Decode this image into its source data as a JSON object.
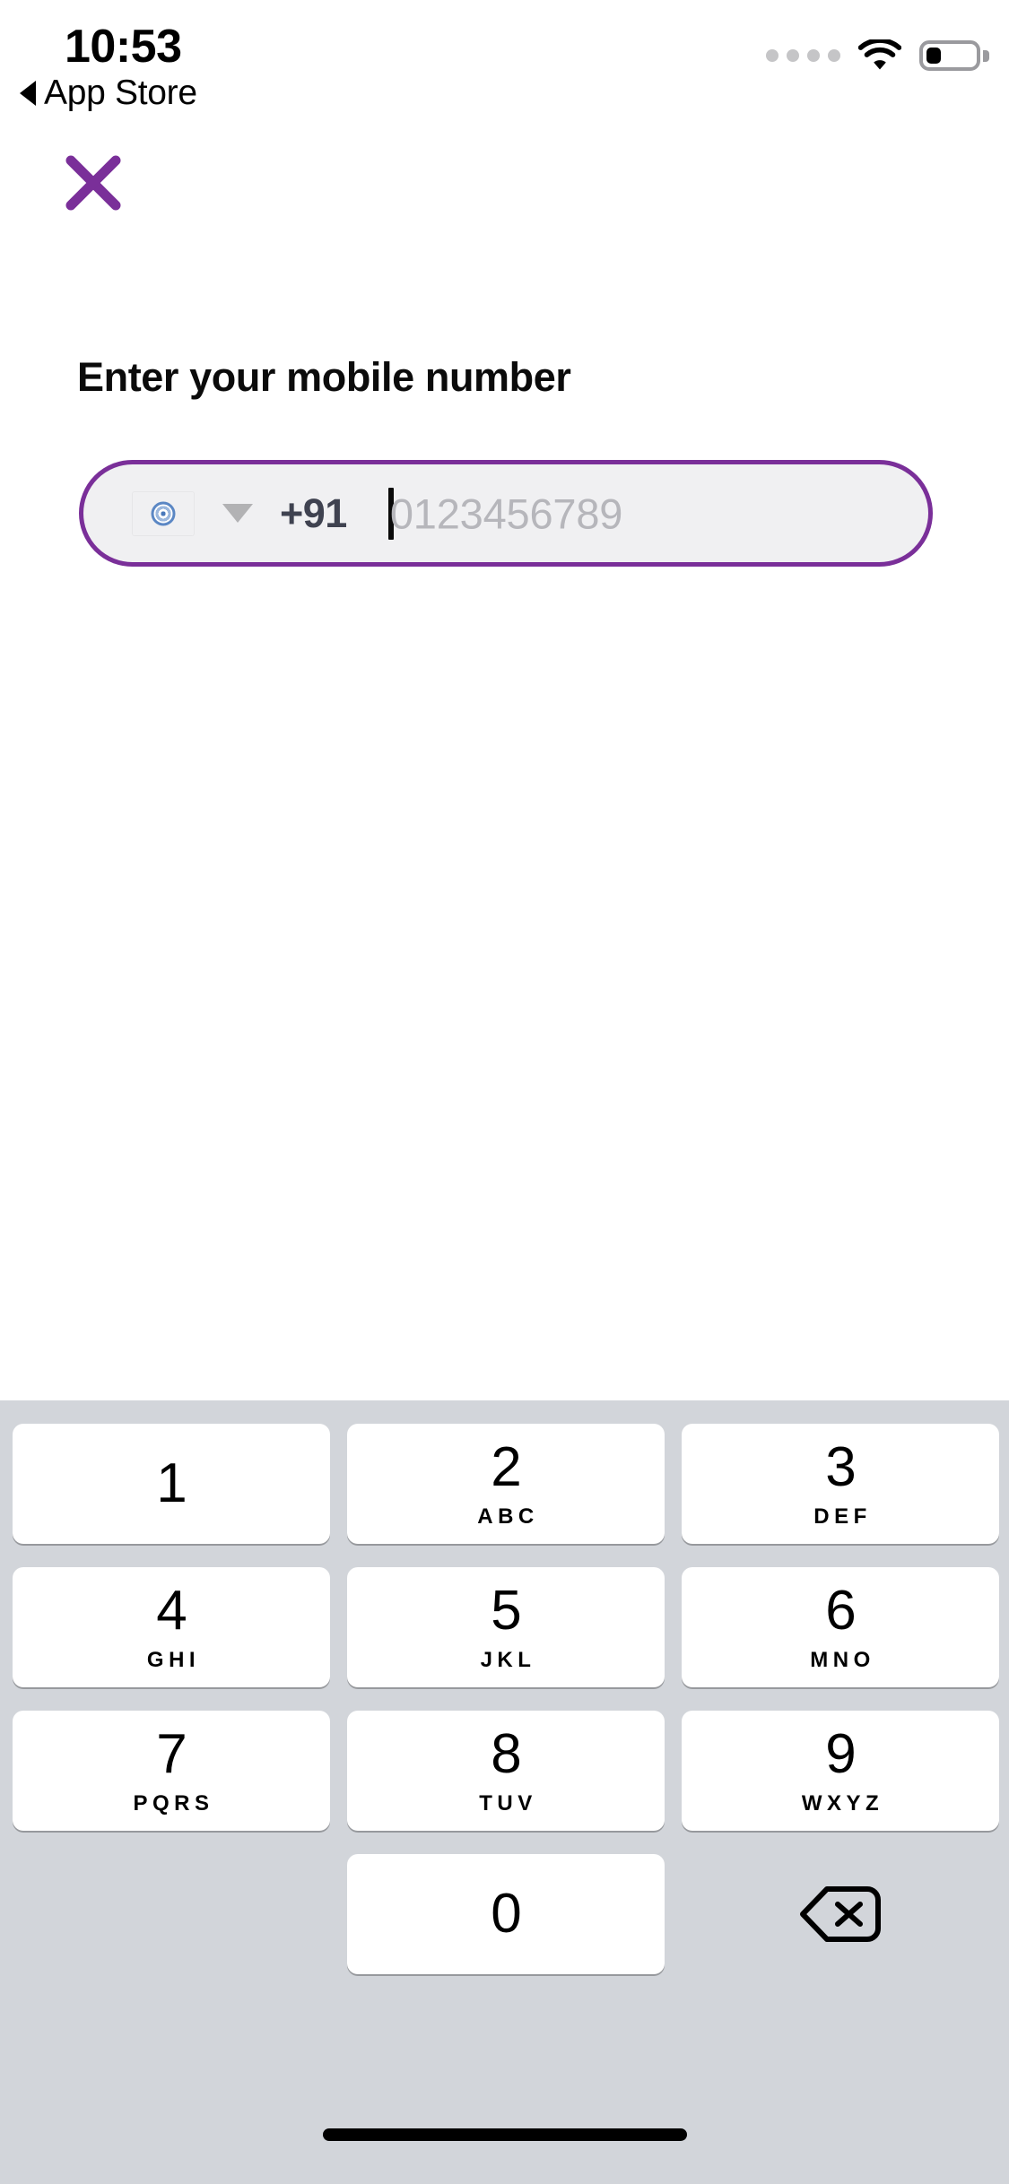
{
  "status_bar": {
    "time": "10:53",
    "back_label": "App Store",
    "back_caret_icon": "triangle-left-icon",
    "signal_icon": "signal-dots-icon",
    "signal_dots": 4,
    "wifi_icon": "wifi-icon",
    "battery_icon": "battery-icon",
    "battery_percent": 30,
    "icon_color": "#c5c5c7",
    "battery_outline_color": "#9a9a9e"
  },
  "header": {
    "close_icon": "close-x-icon",
    "close_color": "#7a2f99"
  },
  "main": {
    "title": "Enter your mobile number",
    "accent_color": "#7a2f99"
  },
  "phone_input": {
    "flag_icon": "india-flag-icon",
    "flag_colors": {
      "saffron": "#e07820",
      "white": "#ffffff",
      "green": "#3e8e27",
      "chakra": "#4a79bb"
    },
    "dropdown_icon": "chevron-down-icon",
    "dropdown_color": "#b2b2b4",
    "country_code": "+91",
    "country_code_color": "#3f4250",
    "value": "",
    "placeholder": "0123456789",
    "placeholder_color": "#b6b6bb",
    "field_background": "#f0f0f2",
    "border_color": "#7a2f99",
    "caret_visible": true
  },
  "keyboard": {
    "background": "#d2d5da",
    "key_background": "#ffffff",
    "rows": [
      [
        {
          "digit": "1",
          "letters": ""
        },
        {
          "digit": "2",
          "letters": "ABC"
        },
        {
          "digit": "3",
          "letters": "DEF"
        }
      ],
      [
        {
          "digit": "4",
          "letters": "GHI"
        },
        {
          "digit": "5",
          "letters": "JKL"
        },
        {
          "digit": "6",
          "letters": "MNO"
        }
      ],
      [
        {
          "digit": "7",
          "letters": "PQRS"
        },
        {
          "digit": "8",
          "letters": "TUV"
        },
        {
          "digit": "9",
          "letters": "WXYZ"
        }
      ],
      [
        {
          "digit": "0",
          "letters": ""
        }
      ]
    ],
    "delete_icon": "backspace-delete-icon"
  },
  "home_indicator": {
    "icon": "home-indicator-bar"
  }
}
